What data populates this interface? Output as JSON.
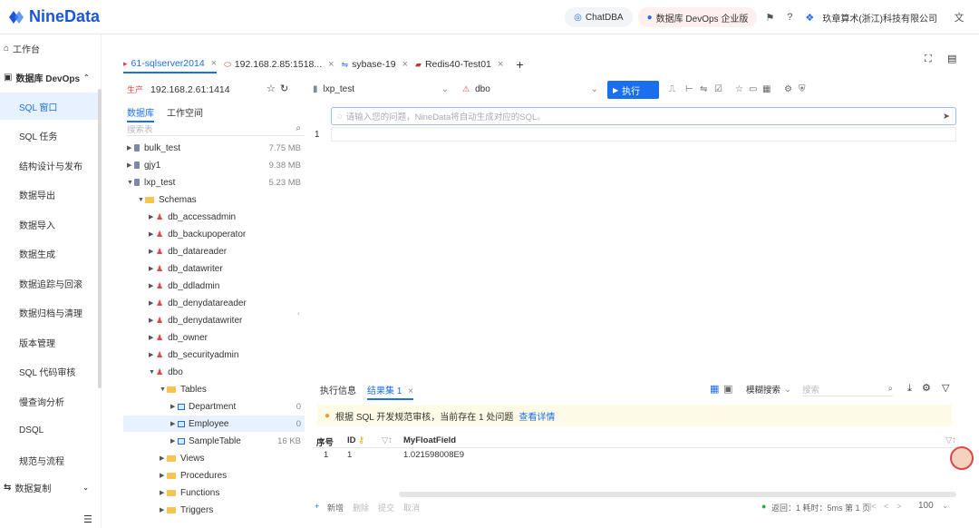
{
  "brand": {
    "name": "NineData"
  },
  "topbar": {
    "chatdba": "ChatDBA",
    "devops": "数据库 DevOps 企业版",
    "company": "玖章算术(浙江)科技有限公司"
  },
  "nav": {
    "workbench": "工作台",
    "devops_head": "数据库 DevOps",
    "items": [
      "SQL 窗口",
      "SQL 任务",
      "结构设计与发布",
      "数据导出",
      "数据导入",
      "数据生成",
      "数据追踪与回滚",
      "数据归档与清理",
      "版本管理",
      "SQL 代码审核",
      "慢查询分析",
      "DSQL",
      "规范与流程"
    ],
    "replication": "数据复制"
  },
  "tabs": [
    {
      "label": "61-sqlserver2014",
      "active": true
    },
    {
      "label": "192.168.2.85:1518...",
      "active": false
    },
    {
      "label": "sybase-19",
      "active": false
    },
    {
      "label": "Redis40-Test01",
      "active": false
    }
  ],
  "conn": {
    "env": "生产",
    "host": "192.168.2.61:1414"
  },
  "panel": {
    "tab_db": "数据库",
    "tab_ws": "工作空间",
    "search_placeholder": "搜索表"
  },
  "tree": [
    {
      "label": "bulk_test",
      "size": "7.75 MB",
      "kind": "db",
      "indent": 0,
      "open": false
    },
    {
      "label": "gjy1",
      "size": "9.38 MB",
      "kind": "db",
      "indent": 0,
      "open": false
    },
    {
      "label": "lxp_test",
      "size": "5.23 MB",
      "kind": "db",
      "indent": 0,
      "open": true
    },
    {
      "label": "Schemas",
      "size": "",
      "kind": "folder",
      "indent": 1,
      "open": true
    },
    {
      "label": "db_accessadmin",
      "size": "",
      "kind": "user",
      "indent": 2,
      "open": false
    },
    {
      "label": "db_backupoperator",
      "size": "",
      "kind": "user",
      "indent": 2,
      "open": false
    },
    {
      "label": "db_datareader",
      "size": "",
      "kind": "user",
      "indent": 2,
      "open": false
    },
    {
      "label": "db_datawriter",
      "size": "",
      "kind": "user",
      "indent": 2,
      "open": false
    },
    {
      "label": "db_ddladmin",
      "size": "",
      "kind": "user",
      "indent": 2,
      "open": false
    },
    {
      "label": "db_denydatareader",
      "size": "",
      "kind": "user",
      "indent": 2,
      "open": false
    },
    {
      "label": "db_denydatawriter",
      "size": "",
      "kind": "user",
      "indent": 2,
      "open": false
    },
    {
      "label": "db_owner",
      "size": "",
      "kind": "user",
      "indent": 2,
      "open": false
    },
    {
      "label": "db_securityadmin",
      "size": "",
      "kind": "user",
      "indent": 2,
      "open": false
    },
    {
      "label": "dbo",
      "size": "",
      "kind": "user",
      "indent": 2,
      "open": true
    },
    {
      "label": "Tables",
      "size": "",
      "kind": "folder",
      "indent": 3,
      "open": true
    },
    {
      "label": "Department",
      "size": "0",
      "kind": "table",
      "indent": 4,
      "open": false
    },
    {
      "label": "Employee",
      "size": "0",
      "kind": "table",
      "indent": 4,
      "open": false,
      "selected": true
    },
    {
      "label": "SampleTable",
      "size": "16 KB",
      "kind": "table",
      "indent": 4,
      "open": false
    },
    {
      "label": "Views",
      "size": "",
      "kind": "folder",
      "indent": 3,
      "open": false
    },
    {
      "label": "Procedures",
      "size": "",
      "kind": "folder",
      "indent": 3,
      "open": false
    },
    {
      "label": "Functions",
      "size": "",
      "kind": "folder",
      "indent": 3,
      "open": false
    },
    {
      "label": "Triggers",
      "size": "",
      "kind": "folder",
      "indent": 3,
      "open": false
    }
  ],
  "editor": {
    "db_select": "lxp_test",
    "schema_select": "dbo",
    "run": "执行",
    "ai_placeholder": "请输入您的问题，NineData将自动生成对应的SQL。",
    "line_number": "1"
  },
  "results": {
    "tab_exec": "执行信息",
    "tab_result": "结果集 1",
    "view_search": "模糊搜索",
    "search_placeholder": "搜索",
    "warning": "根据 SQL 开发规范审核，当前存在 1 处问题",
    "warning_link": "查看详情",
    "columns": [
      "序号",
      "ID",
      "MyFloatField"
    ],
    "rows": [
      [
        "1",
        "1",
        "1.021598008E9"
      ]
    ],
    "footer_actions": [
      "新增",
      "删除",
      "提交",
      "取消"
    ],
    "status": "返回：1 耗时：5ms 第 1 页",
    "page_size": "100"
  }
}
